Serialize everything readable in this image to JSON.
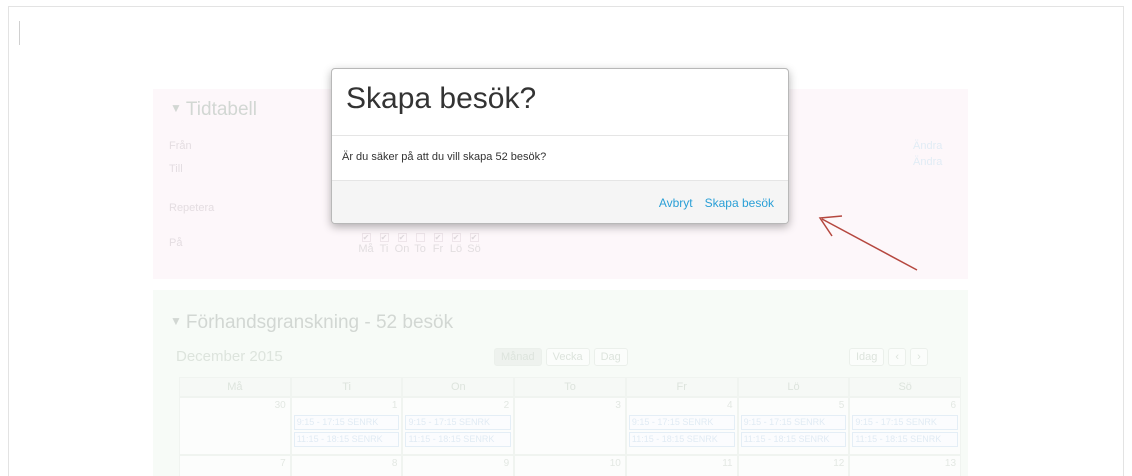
{
  "background": {
    "tidtabell": {
      "title": "Tidtabell",
      "labels": [
        "Från",
        "Till",
        "Repetera",
        "På"
      ],
      "andra_links": [
        "Ändra",
        "Ändra"
      ],
      "days": [
        "Må",
        "Ti",
        "On",
        "To",
        "Fr",
        "Lö",
        "Sö"
      ],
      "day_checked": [
        true,
        true,
        true,
        false,
        true,
        true,
        true
      ]
    },
    "preview": {
      "title": "Förhandsgranskning - 52 besök",
      "month": "December 2015",
      "view_buttons": [
        "Månad",
        "Vecka",
        "Dag"
      ],
      "today_button": "Idag",
      "prev_icon": "chevron-left-icon",
      "next_icon": "chevron-right-icon",
      "weekdays": [
        "Må",
        "Ti",
        "On",
        "To",
        "Fr",
        "Lö",
        "Sö"
      ],
      "week1_days": [
        "30",
        "1",
        "2",
        "3",
        "4",
        "5",
        "6"
      ],
      "week2_days": [
        "7",
        "8",
        "9",
        "10",
        "11",
        "12",
        "13"
      ],
      "event_a": "9:15 - 17:15 SENRK",
      "event_b": "11:15 - 18:15 SENRK",
      "event_cols": [
        false,
        true,
        true,
        false,
        true,
        true,
        true
      ]
    }
  },
  "modal": {
    "title": "Skapa besök?",
    "message": "Är du säker på att du vill skapa 52 besök?",
    "cancel_label": "Avbryt",
    "confirm_label": "Skapa besök"
  },
  "colors": {
    "link": "#2a9fd6",
    "annotation_arrow": "#b5473f"
  }
}
